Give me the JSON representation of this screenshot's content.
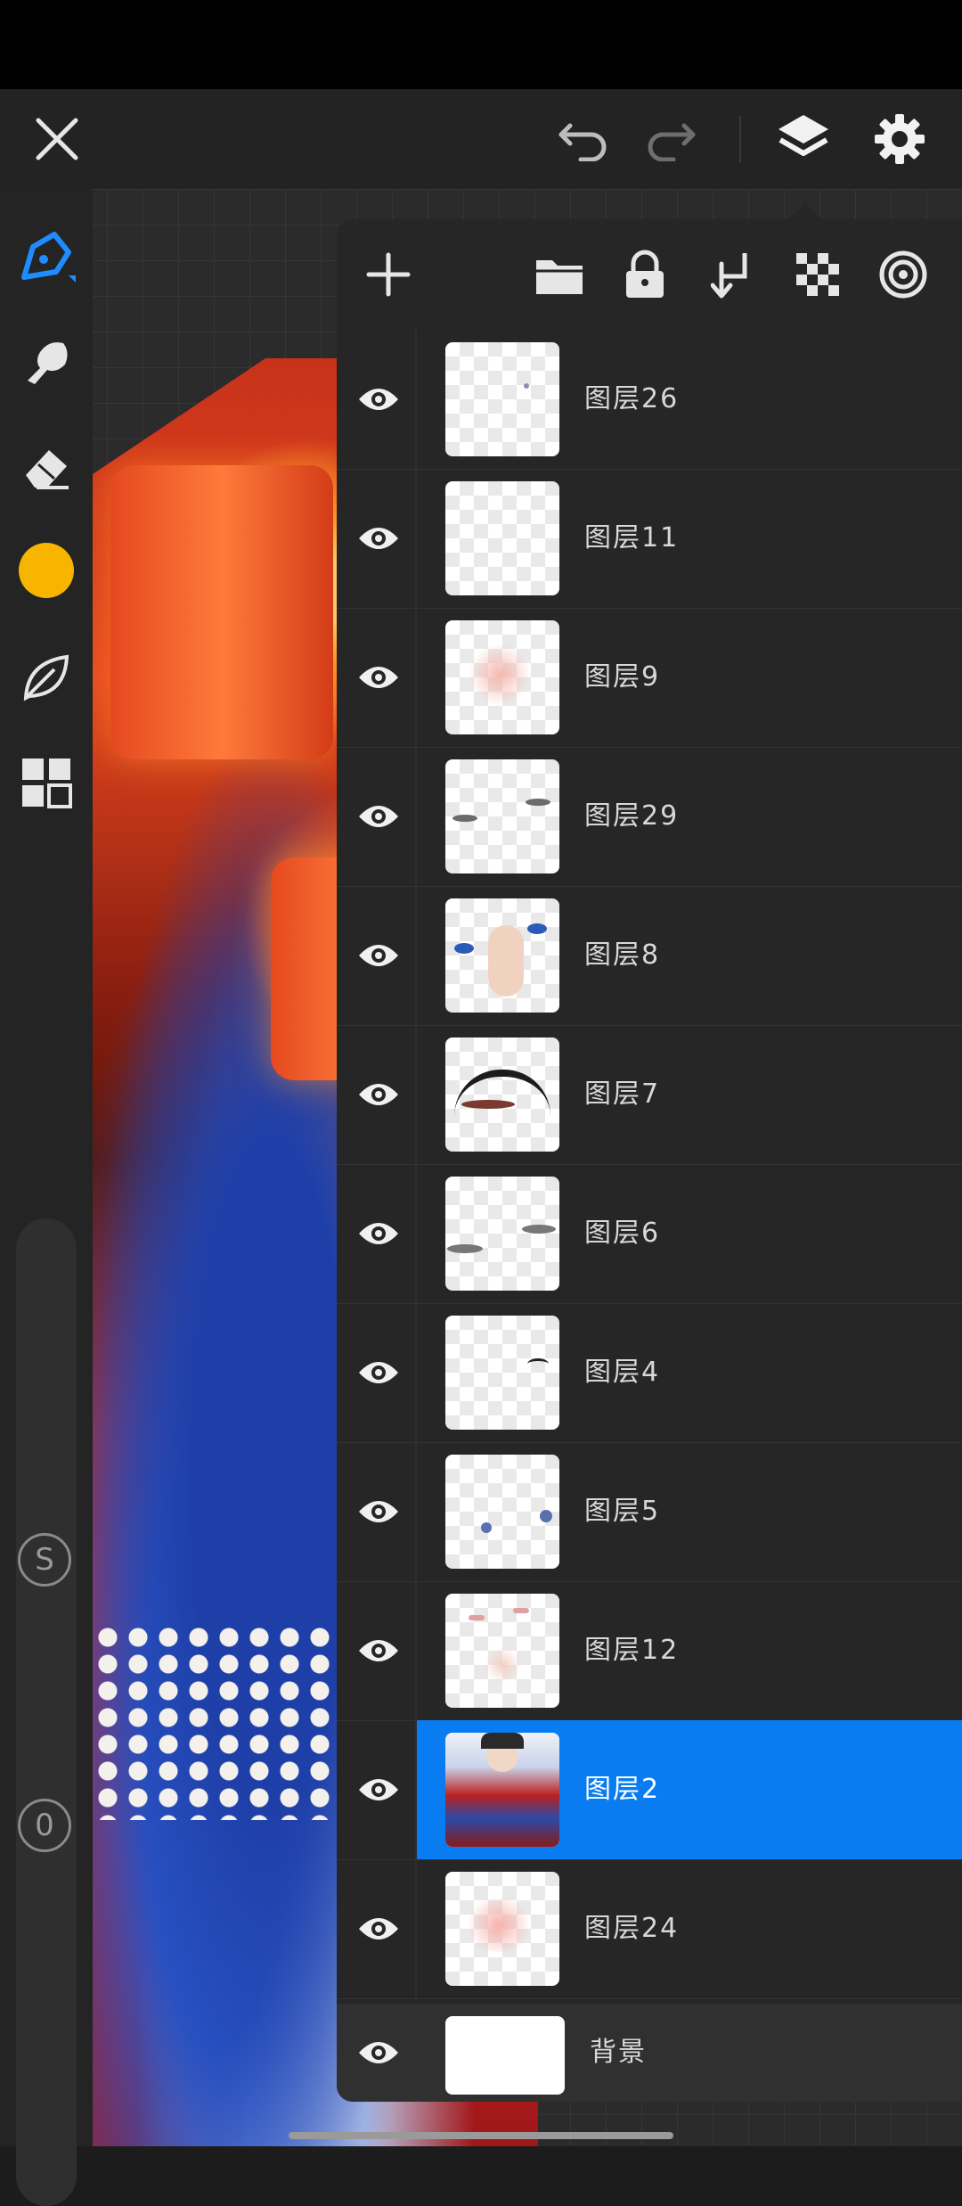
{
  "header": {
    "close_icon": "close-icon",
    "undo_icon": "undo-icon",
    "redo_icon": "redo-icon",
    "layers_icon": "layers-icon",
    "settings_icon": "gear-icon"
  },
  "toolbar": {
    "tools": [
      "brush-icon",
      "smudge-icon",
      "eraser-icon",
      "color-swatch",
      "leaf-icon",
      "gallery-icon"
    ],
    "current_color": "#f7b500",
    "size_button": "S",
    "opacity_button": "0"
  },
  "layers_panel": {
    "actions": [
      "add-icon",
      "folder-icon",
      "lock-icon",
      "merge-down-icon",
      "transparency-icon",
      "reference-icon"
    ],
    "layers": [
      {
        "name": "图层26",
        "visible": true,
        "selected": false
      },
      {
        "name": "图层11",
        "visible": true,
        "selected": false
      },
      {
        "name": "图层9",
        "visible": true,
        "selected": false
      },
      {
        "name": "图层29",
        "visible": true,
        "selected": false
      },
      {
        "name": "图层8",
        "visible": true,
        "selected": false
      },
      {
        "name": "图层7",
        "visible": true,
        "selected": false
      },
      {
        "name": "图层6",
        "visible": true,
        "selected": false
      },
      {
        "name": "图层4",
        "visible": true,
        "selected": false
      },
      {
        "name": "图层5",
        "visible": true,
        "selected": false
      },
      {
        "name": "图层12",
        "visible": true,
        "selected": false
      },
      {
        "name": "图层2",
        "visible": true,
        "selected": true
      },
      {
        "name": "图层24",
        "visible": true,
        "selected": false
      }
    ],
    "background_layer": {
      "name": "背景",
      "visible": true
    }
  },
  "colors": {
    "accent": "#0a7cf2",
    "panel": "#262626",
    "topbar": "#232323"
  }
}
